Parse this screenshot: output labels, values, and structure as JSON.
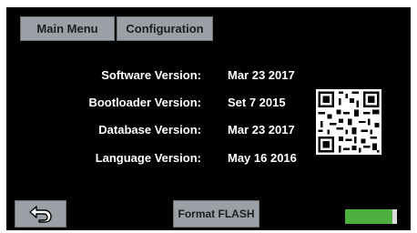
{
  "tabs": {
    "main_menu": "Main Menu",
    "configuration": "Configuration"
  },
  "info": [
    {
      "label": "Software Version:",
      "value": "Mar 23 2017"
    },
    {
      "label": "Bootloader Version:",
      "value": "Set 7 2015"
    },
    {
      "label": "Database Version:",
      "value": "Mar 23 2017"
    },
    {
      "label": "Language Version:",
      "value": "May 16 2016"
    }
  ],
  "buttons": {
    "back_icon": "back-arrow-icon",
    "format_flash": "Format FLASH"
  },
  "progress": {
    "fraction": 0.92,
    "color": "#4caf3e"
  },
  "colors": {
    "screen_bg": "#000000",
    "button_bg": "#9aa0a5"
  }
}
